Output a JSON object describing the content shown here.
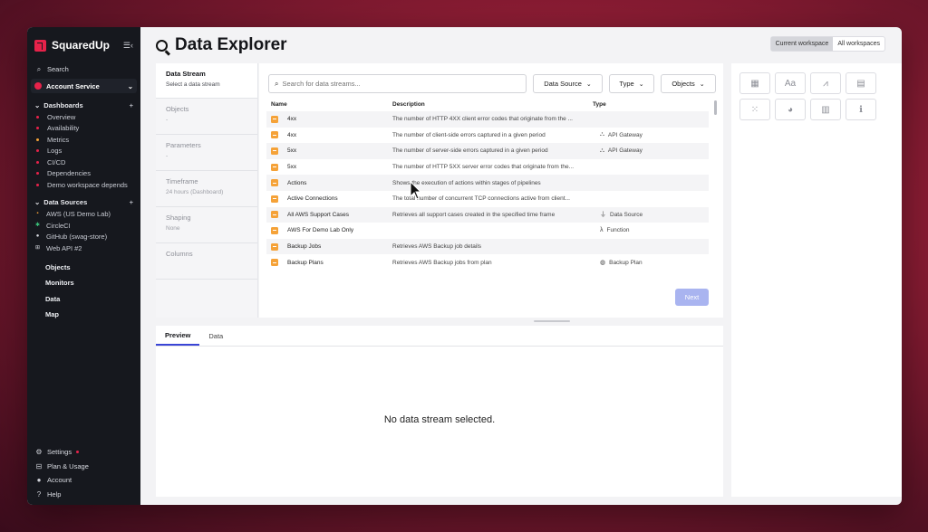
{
  "app": {
    "name": "SquaredUp"
  },
  "sidebar": {
    "search_label": "Search",
    "workspace": "Account Service",
    "dashboards_heading": "Dashboards",
    "dashboards": [
      {
        "label": "Overview",
        "color": "#e6224a"
      },
      {
        "label": "Availability",
        "color": "#e6224a"
      },
      {
        "label": "Metrics",
        "color": "#f5a238"
      },
      {
        "label": "Logs",
        "color": "#e6224a"
      },
      {
        "label": "CI/CD",
        "color": "#e6224a"
      },
      {
        "label": "Dependencies",
        "color": "#e6224a"
      },
      {
        "label": "Demo workspace depends",
        "color": "#e6224a"
      }
    ],
    "datasources_heading": "Data Sources",
    "datasources": [
      {
        "label": "AWS (US Demo Lab)",
        "icon": "aws-icon"
      },
      {
        "label": "CircleCI",
        "icon": "circleci-icon"
      },
      {
        "label": "GitHub (swag-store)",
        "icon": "github-icon"
      },
      {
        "label": "Web API #2",
        "icon": "webapi-icon"
      }
    ],
    "nav": [
      "Objects",
      "Monitors",
      "Data",
      "Map"
    ],
    "bottom": [
      "Settings",
      "Plan & Usage",
      "Account",
      "Help"
    ]
  },
  "header": {
    "title": "Data Explorer",
    "current_workspace": "Current workspace",
    "all_workspaces": "All workspaces"
  },
  "steps": [
    {
      "label": "Data Stream",
      "sub": "Select a data stream"
    },
    {
      "label": "Objects",
      "sub": "-"
    },
    {
      "label": "Parameters",
      "sub": "-"
    },
    {
      "label": "Timeframe",
      "sub": "24 hours (Dashboard)"
    },
    {
      "label": "Shaping",
      "sub": "None"
    },
    {
      "label": "Columns",
      "sub": ""
    }
  ],
  "stream": {
    "search_placeholder": "Search for data streams...",
    "filters": {
      "source": "Data Source",
      "type": "Type",
      "objects": "Objects"
    },
    "columns": {
      "name": "Name",
      "description": "Description",
      "type": "Type"
    },
    "rows": [
      {
        "name": "4xx",
        "description": "The number of HTTP 4XX client error codes that originate from the ...",
        "type": "",
        "type_icon": ""
      },
      {
        "name": "4xx",
        "description": "The number of client-side errors captured in a given period",
        "type": "API Gateway",
        "type_icon": "⛬"
      },
      {
        "name": "5xx",
        "description": "The number of server-side errors captured in a given period",
        "type": "API Gateway",
        "type_icon": "⛬"
      },
      {
        "name": "5xx",
        "description": "The number of HTTP 5XX server error codes that originate from the...",
        "type": "",
        "type_icon": ""
      },
      {
        "name": "Actions",
        "description": "Shows the execution of actions within stages of pipelines",
        "type": "",
        "type_icon": ""
      },
      {
        "name": "Active Connections",
        "description": "The total number of concurrent TCP connections active from client...",
        "type": "",
        "type_icon": ""
      },
      {
        "name": "All AWS Support Cases",
        "description": "Retrieves all support cases created in the specified time frame",
        "type": "Data Source",
        "type_icon": "⏚"
      },
      {
        "name": "AWS For Demo Lab Only",
        "description": "",
        "type": "Function",
        "type_icon": "λ"
      },
      {
        "name": "Backup Jobs",
        "description": "Retrieves AWS Backup job details",
        "type": "",
        "type_icon": ""
      },
      {
        "name": "Backup Plans",
        "description": "Retrieves AWS Backup jobs from plan",
        "type": "Backup Plan",
        "type_icon": "◍"
      }
    ],
    "next_label": "Next"
  },
  "preview": {
    "tabs": [
      "Preview",
      "Data"
    ],
    "empty_message": "No data stream selected."
  },
  "viz": {
    "buttons": [
      {
        "icon": "▦",
        "name": "table-viz-icon"
      },
      {
        "icon": "Aa",
        "name": "text-viz-icon"
      },
      {
        "icon": "⩘",
        "name": "line-graph-viz-icon"
      },
      {
        "icon": "▤",
        "name": "scalar-viz-icon"
      },
      {
        "icon": "⁙",
        "name": "blocks-viz-icon"
      },
      {
        "icon": "◕",
        "name": "donut-viz-icon"
      },
      {
        "icon": "▥",
        "name": "gauge-viz-icon"
      },
      {
        "icon": "ℹ",
        "name": "status-viz-icon"
      }
    ]
  }
}
